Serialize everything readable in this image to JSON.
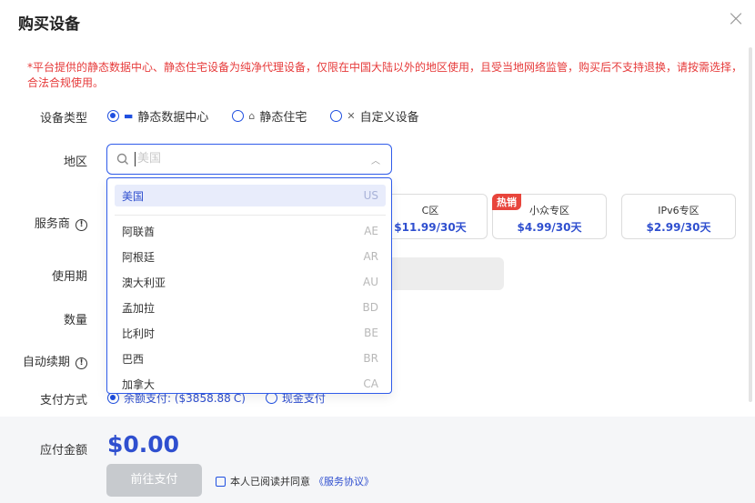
{
  "dialog": {
    "title": "购买设备",
    "close_icon": "close-icon"
  },
  "notice": "*平台提供的静态数据中心、静态住宅设备为纯净代理设备，仅限在中国大陆以外的地区使用，且受当地网络监管，购买后不支持退换，请按需选择，合法合规使用。",
  "labels": {
    "device_type": "设备类型",
    "region": "地区",
    "provider": "服务商",
    "period": "使用期",
    "quantity": "数量",
    "auto_renew": "自动续期",
    "pay_method": "支付方式",
    "amount": "应付金额"
  },
  "device_types": [
    {
      "label": "静态数据中心",
      "selected": true,
      "icon": "server-icon"
    },
    {
      "label": "静态住宅",
      "selected": false,
      "icon": "residential-icon"
    },
    {
      "label": "自定义设备",
      "selected": false,
      "icon": "custom-tools-icon"
    }
  ],
  "region_select": {
    "placeholder": "美国",
    "icon": "search-icon"
  },
  "regions": [
    {
      "name": "美国",
      "code": "US",
      "selected": true
    },
    {
      "name": "阿联酋",
      "code": "AE"
    },
    {
      "name": "阿根廷",
      "code": "AR"
    },
    {
      "name": "澳大利亚",
      "code": "AU"
    },
    {
      "name": "孟加拉",
      "code": "BD"
    },
    {
      "name": "比利时",
      "code": "BE"
    },
    {
      "name": "巴西",
      "code": "BR"
    },
    {
      "name": "加拿大",
      "code": "CA"
    }
  ],
  "provider_cards": [
    {
      "name": "C区",
      "price": "$11.99/30天",
      "badge": ""
    },
    {
      "name": "小众专区",
      "price": "$4.99/30天",
      "badge": "热销"
    },
    {
      "name": "IPv6专区",
      "price": "$2.99/30天",
      "badge": ""
    }
  ],
  "pay_methods": {
    "balance": "余额支付: ($3858.88",
    "cash": "现金支付"
  },
  "footer": {
    "amount": "$0.00",
    "pay_button": "前往支付",
    "agree_text": "本人已阅读并同意",
    "agreement_link": "《服务协议》"
  },
  "colors": {
    "accent": "#2f4fcf",
    "warning": "#e63a3a",
    "hot": "#e8453c"
  }
}
